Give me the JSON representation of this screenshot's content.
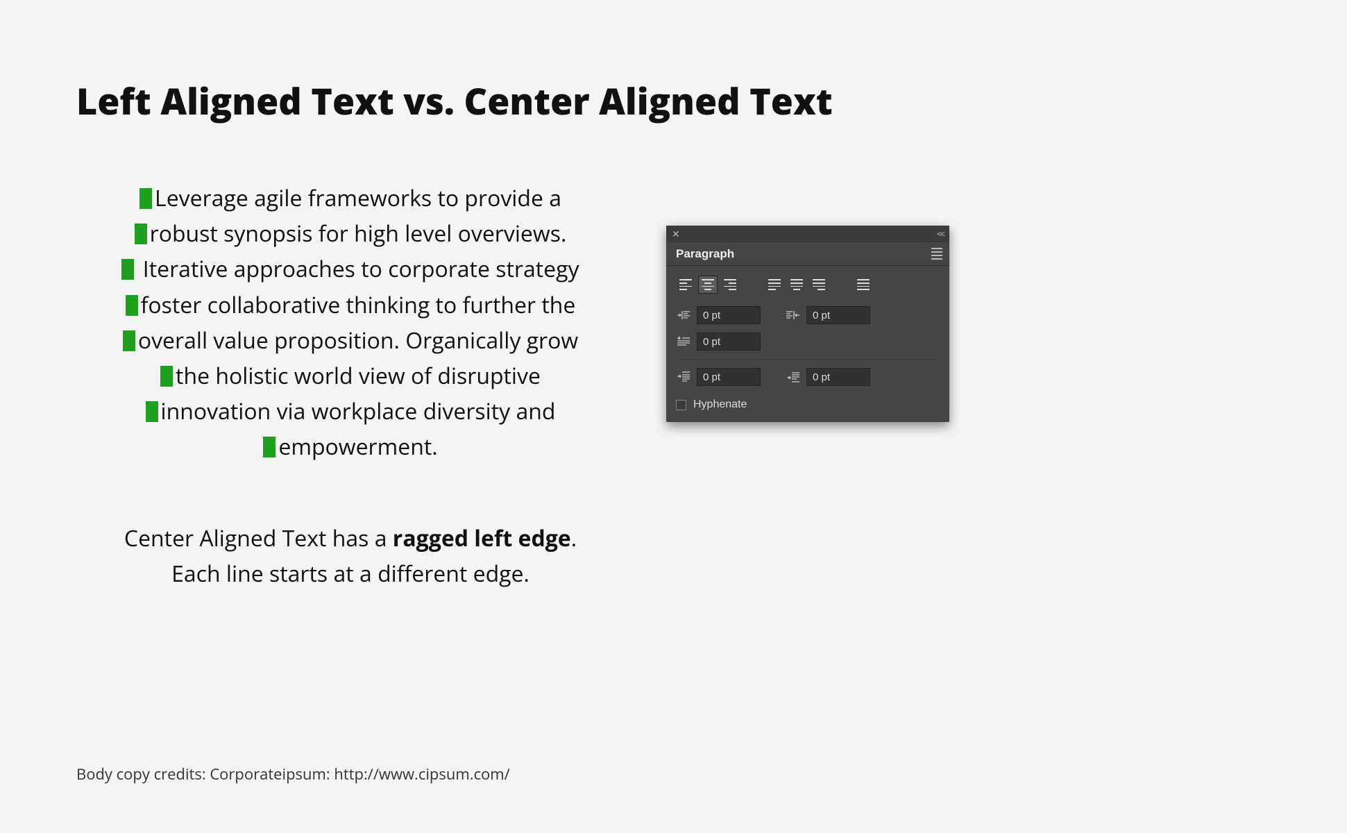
{
  "title": "Left Aligned Text vs. Center Aligned Text",
  "body_lines": [
    "Leverage agile frameworks to provide a",
    "robust synopsis for high level overviews.",
    " Iterative approaches to corporate strategy",
    "foster collaborative thinking to further the",
    "overall value proposition. Organically grow",
    "the holistic world view of disruptive",
    "innovation via workplace diversity and",
    "empowerment."
  ],
  "caption": {
    "line1_pre": "Center Aligned Text has a ",
    "line1_bold": "ragged left edge",
    "line1_post": ".",
    "line2": "Each line starts at a different edge."
  },
  "credits": "Body copy credits: Corporateipsum: http://www.cipsum.com/",
  "panel": {
    "tab_label": "Paragraph",
    "fields": {
      "indent_left": "0 pt",
      "indent_right": "0 pt",
      "first_line": "0 pt",
      "space_before": "0 pt",
      "space_after": "0 pt"
    },
    "hyphenate_label": "Hyphenate",
    "hyphenate_checked": false,
    "active_alignment": "center"
  }
}
